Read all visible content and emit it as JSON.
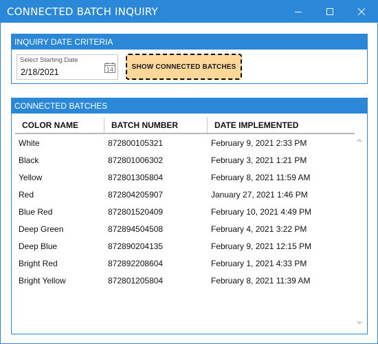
{
  "window": {
    "title": "CONNECTED BATCH INQUIRY"
  },
  "criteria": {
    "header": "INQUIRY DATE CRITERIA",
    "date_label": "Select Starting Date",
    "date_value": "2/18/2021",
    "calendar_day": "14",
    "button_label": "SHOW CONNECTED BATCHES"
  },
  "batches": {
    "header": "CONNECTED BATCHES",
    "columns": [
      "COLOR NAME",
      "BATCH NUMBER",
      "DATE IMPLEMENTED"
    ],
    "rows": [
      [
        "White",
        "872800105321",
        "February 9, 2021 2:33 PM"
      ],
      [
        "Black",
        "872801006302",
        "February 3, 2021 1:21 PM"
      ],
      [
        "Yellow",
        "872801305804",
        "February 8, 2021 11:59 AM"
      ],
      [
        "Red",
        "872804205907",
        "January 27, 2021 1:46 PM"
      ],
      [
        "Blue Red",
        "872801520409",
        "February 10, 2021 4:49 PM"
      ],
      [
        "Deep Green",
        "872894504508",
        "February 4, 2021 3:22 PM"
      ],
      [
        "Deep Blue",
        "872890204135",
        "February 9, 2021 12:15 PM"
      ],
      [
        "Bright Red",
        "872892208604",
        "February 1, 2021 4:33 PM"
      ],
      [
        "Bright Yellow",
        "872801205804",
        "February 8, 2021 11:39 AM"
      ]
    ]
  },
  "colors": {
    "accent": "#2b88d8",
    "button_fill": "#ffd799"
  }
}
